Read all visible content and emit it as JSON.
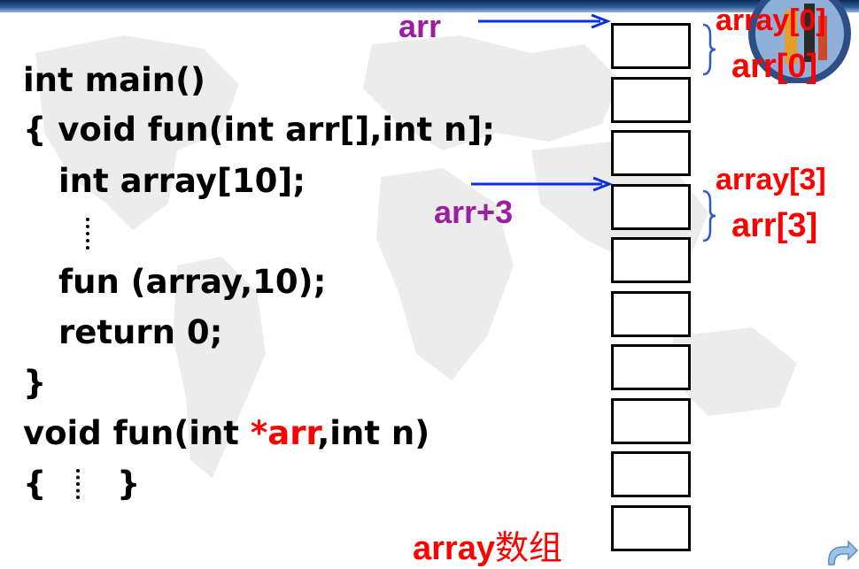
{
  "code": {
    "lines": [
      "int main()",
      "{ void fun(int arr[],int n];",
      "int array[10];",
      "fun (array,10);",
      "return 0;",
      "}",
      "{",
      "}"
    ],
    "fun_def": {
      "prefix": "void fun(int ",
      "highlight": "*arr",
      "suffix": ",int n)"
    }
  },
  "diagram": {
    "pointer_arr": "arr",
    "pointer_arr3": "arr+3",
    "label_array0": "array[0]",
    "label_arr0": "arr[0]",
    "label_array3": "array[3]",
    "label_arr3": "arr[3]",
    "caption_latin": "array",
    "caption_cjk": "数组",
    "cell_count": 10,
    "colors": {
      "pointer": "#9b1fa0",
      "arrow": "#0a2fe0",
      "element_label": "#ff0000",
      "brace": "#2a5ad0"
    }
  },
  "decor": {
    "logo_icon": "tools-badge-icon",
    "nav_icon": "return-arrow-icon"
  }
}
